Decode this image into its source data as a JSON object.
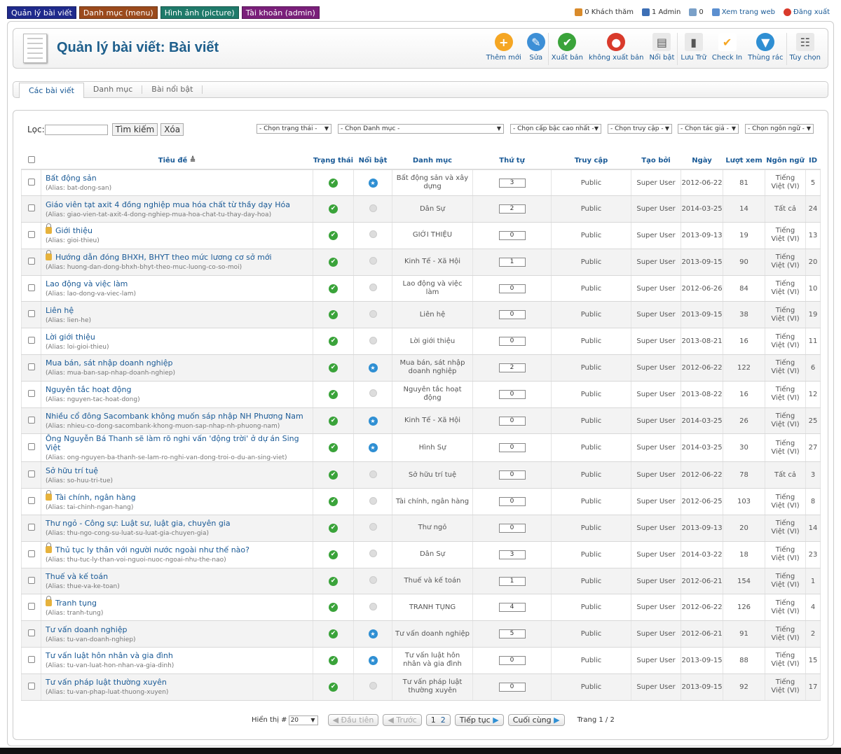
{
  "topmenu": [
    {
      "label": "Quản lý bài viết",
      "color": "#1f2a8c"
    },
    {
      "label": "Danh mục (menu)",
      "color": "#9b4a1c"
    },
    {
      "label": "Hình ảnh (picture)",
      "color": "#1f7a6a"
    },
    {
      "label": "Tài khoản (admin)",
      "color": "#7a1f7a"
    }
  ],
  "topright": {
    "guests": "0 Khách thăm",
    "admins": "1 Admin",
    "messages": "0",
    "view_site": "Xem trang web",
    "logout": "Đăng xuất"
  },
  "header": {
    "title": "Quản lý bài viết: Bài viết"
  },
  "toolbar": [
    {
      "label": "Thêm mới",
      "color": "#f5a623",
      "glyph": "+"
    },
    {
      "label": "Sửa",
      "color": "#3d8fd6",
      "glyph": "✎"
    },
    {
      "label": "Xuất bản",
      "color": "#3aa33a",
      "glyph": "✔"
    },
    {
      "label": "không xuất bản",
      "color": "#d93a2b",
      "glyph": "●"
    },
    {
      "label": "Nổi bật",
      "color": "#e9e9e9",
      "glyph": "▤"
    },
    {
      "label": "Lưu Trữ",
      "color": "#e9e9e9",
      "glyph": "▮"
    },
    {
      "label": "Check In",
      "color": "#ffffff",
      "glyph": "✔"
    },
    {
      "label": "Thùng rác",
      "color": "#2f8fd3",
      "glyph": "▼"
    },
    {
      "label": "Tùy chọn",
      "color": "#e9e9e9",
      "glyph": "☷"
    }
  ],
  "submenu": [
    "Các bài viết",
    "Danh mục",
    "Bài nổi bật"
  ],
  "filter": {
    "label": "Lọc:",
    "search_btn": "Tìm kiếm",
    "clear_btn": "Xóa"
  },
  "selects": [
    "- Chọn trạng thái -",
    "- Chọn Danh mục -",
    "- Chọn cấp bậc cao nhất -",
    "- Chọn truy cập -",
    "- Chọn tác giả -",
    "- Chọn ngôn ngữ -"
  ],
  "columns": [
    "Tiêu đề",
    "Trạng thái",
    "Nổi bật",
    "Danh mục",
    "Thứ tự",
    "Truy cập",
    "Tạo bởi",
    "Ngày",
    "Lượt xem",
    "Ngôn ngữ",
    "ID"
  ],
  "rows": [
    {
      "title": "Bất động sản",
      "alias": "(Alias: bat-dong-san)",
      "locked": false,
      "featured": true,
      "category": "Bất động sản và xây dựng",
      "order": "3",
      "access": "Public",
      "author": "Super User",
      "date": "2012-06-22",
      "hits": "81",
      "lang": "Tiếng Việt (VI)",
      "id": "5"
    },
    {
      "title": "Giáo viên tạt axit 4 đồng nghiệp mua hóa chất từ thầy dạy Hóa",
      "alias": "(Alias: giao-vien-tat-axit-4-dong-nghiep-mua-hoa-chat-tu-thay-day-hoa)",
      "locked": false,
      "featured": false,
      "category": "Dân Sự",
      "order": "2",
      "access": "Public",
      "author": "Super User",
      "date": "2014-03-25",
      "hits": "14",
      "lang": "Tất cả",
      "id": "24"
    },
    {
      "title": "Giới thiệu",
      "alias": "(Alias: gioi-thieu)",
      "locked": true,
      "featured": false,
      "category": "GIỚI THIỆU",
      "order": "0",
      "access": "Public",
      "author": "Super User",
      "date": "2013-09-13",
      "hits": "19",
      "lang": "Tiếng Việt (VI)",
      "id": "13"
    },
    {
      "title": "Hướng dẫn đóng BHXH, BHYT theo mức lương cơ sở mới",
      "alias": "(Alias: huong-dan-dong-bhxh-bhyt-theo-muc-luong-co-so-moi)",
      "locked": true,
      "featured": false,
      "category": "Kinh Tế - Xã Hội",
      "order": "1",
      "access": "Public",
      "author": "Super User",
      "date": "2013-09-15",
      "hits": "90",
      "lang": "Tiếng Việt (VI)",
      "id": "20"
    },
    {
      "title": "Lao động và việc làm",
      "alias": "(Alias: lao-dong-va-viec-lam)",
      "locked": false,
      "featured": false,
      "category": "Lao động và việc làm",
      "order": "0",
      "access": "Public",
      "author": "Super User",
      "date": "2012-06-26",
      "hits": "84",
      "lang": "Tiếng Việt (VI)",
      "id": "10"
    },
    {
      "title": "Liên hệ",
      "alias": "(Alias: lien-he)",
      "locked": false,
      "featured": false,
      "category": "Liên hệ",
      "order": "0",
      "access": "Public",
      "author": "Super User",
      "date": "2013-09-15",
      "hits": "38",
      "lang": "Tiếng Việt (VI)",
      "id": "19"
    },
    {
      "title": "Lời giới thiệu",
      "alias": "(Alias: loi-gioi-thieu)",
      "locked": false,
      "featured": false,
      "category": "Lời giới thiệu",
      "order": "0",
      "access": "Public",
      "author": "Super User",
      "date": "2013-08-21",
      "hits": "16",
      "lang": "Tiếng Việt (VI)",
      "id": "11"
    },
    {
      "title": "Mua bán, sát nhập doanh nghiệp",
      "alias": "(Alias: mua-ban-sap-nhap-doanh-nghiep)",
      "locked": false,
      "featured": true,
      "category": "Mua bán, sát nhập doanh nghiệp",
      "order": "2",
      "access": "Public",
      "author": "Super User",
      "date": "2012-06-22",
      "hits": "122",
      "lang": "Tiếng Việt (VI)",
      "id": "6"
    },
    {
      "title": "Nguyên tắc hoạt động",
      "alias": "(Alias: nguyen-tac-hoat-dong)",
      "locked": false,
      "featured": false,
      "category": "Nguyên tắc hoạt động",
      "order": "0",
      "access": "Public",
      "author": "Super User",
      "date": "2013-08-22",
      "hits": "16",
      "lang": "Tiếng Việt (VI)",
      "id": "12"
    },
    {
      "title": "Nhiều cổ đông Sacombank không muốn sáp nhập NH Phương Nam",
      "alias": "(Alias: nhieu-co-dong-sacombank-khong-muon-sap-nhap-nh-phuong-nam)",
      "locked": false,
      "featured": true,
      "category": "Kinh Tế - Xã Hội",
      "order": "0",
      "access": "Public",
      "author": "Super User",
      "date": "2014-03-25",
      "hits": "26",
      "lang": "Tiếng Việt (VI)",
      "id": "25"
    },
    {
      "title": "Ông Nguyễn Bá Thanh sẽ làm rõ nghi vấn 'động trời' ở dự án Sing Việt",
      "alias": "(Alias: ong-nguyen-ba-thanh-se-lam-ro-nghi-van-dong-troi-o-du-an-sing-viet)",
      "locked": false,
      "featured": true,
      "category": "Hình Sự",
      "order": "0",
      "access": "Public",
      "author": "Super User",
      "date": "2014-03-25",
      "hits": "30",
      "lang": "Tiếng Việt (VI)",
      "id": "27"
    },
    {
      "title": "Sở hữu trí tuệ",
      "alias": "(Alias: so-huu-tri-tue)",
      "locked": false,
      "featured": false,
      "category": "Sở hữu trí tuệ",
      "order": "0",
      "access": "Public",
      "author": "Super User",
      "date": "2012-06-22",
      "hits": "78",
      "lang": "Tất cả",
      "id": "3"
    },
    {
      "title": "Tài chính, ngân hàng",
      "alias": "(Alias: tai-chinh-ngan-hang)",
      "locked": true,
      "featured": false,
      "category": "Tài chính, ngân hàng",
      "order": "0",
      "access": "Public",
      "author": "Super User",
      "date": "2012-06-25",
      "hits": "103",
      "lang": "Tiếng Việt (VI)",
      "id": "8"
    },
    {
      "title": "Thư ngỏ - Công sự: Luật sư, luật gia, chuyên gia",
      "alias": "(Alias: thu-ngo-cong-su-luat-su-luat-gia-chuyen-gia)",
      "locked": false,
      "featured": false,
      "category": "Thư ngỏ",
      "order": "0",
      "access": "Public",
      "author": "Super User",
      "date": "2013-09-13",
      "hits": "20",
      "lang": "Tiếng Việt (VI)",
      "id": "14"
    },
    {
      "title": "Thủ tục ly thân với người nước ngoài như thế nào?",
      "alias": "(Alias: thu-tuc-ly-than-voi-nguoi-nuoc-ngoai-nhu-the-nao)",
      "locked": true,
      "featured": false,
      "category": "Dân Sự",
      "order": "3",
      "access": "Public",
      "author": "Super User",
      "date": "2014-03-22",
      "hits": "18",
      "lang": "Tiếng Việt (VI)",
      "id": "23"
    },
    {
      "title": "Thuế và kế toán",
      "alias": "(Alias: thue-va-ke-toan)",
      "locked": false,
      "featured": false,
      "category": "Thuế và kế toán",
      "order": "1",
      "access": "Public",
      "author": "Super User",
      "date": "2012-06-21",
      "hits": "154",
      "lang": "Tiếng Việt (VI)",
      "id": "1"
    },
    {
      "title": "Tranh tụng",
      "alias": "(Alias: tranh-tung)",
      "locked": true,
      "featured": false,
      "category": "TRANH TỤNG",
      "order": "4",
      "access": "Public",
      "author": "Super User",
      "date": "2012-06-22",
      "hits": "126",
      "lang": "Tiếng Việt (VI)",
      "id": "4"
    },
    {
      "title": "Tư vấn doanh nghiệp",
      "alias": "(Alias: tu-van-doanh-nghiep)",
      "locked": false,
      "featured": true,
      "category": "Tư vấn doanh nghiệp",
      "order": "5",
      "access": "Public",
      "author": "Super User",
      "date": "2012-06-21",
      "hits": "91",
      "lang": "Tiếng Việt (VI)",
      "id": "2"
    },
    {
      "title": "Tư vấn luật hôn nhân và gia đình",
      "alias": "(Alias: tu-van-luat-hon-nhan-va-gia-dinh)",
      "locked": false,
      "featured": true,
      "category": "Tư vấn luật hôn nhân và gia đình",
      "order": "0",
      "access": "Public",
      "author": "Super User",
      "date": "2013-09-15",
      "hits": "88",
      "lang": "Tiếng Việt (VI)",
      "id": "15"
    },
    {
      "title": "Tư vấn pháp luật thường xuyên",
      "alias": "(Alias: tu-van-phap-luat-thuong-xuyen)",
      "locked": false,
      "featured": false,
      "category": "Tư vấn pháp luật thường xuyên",
      "order": "0",
      "access": "Public",
      "author": "Super User",
      "date": "2013-09-15",
      "hits": "92",
      "lang": "Tiếng Việt (VI)",
      "id": "17"
    }
  ],
  "pager": {
    "show_label": "Hiển thị #",
    "show_value": "20",
    "first": "Đầu tiên",
    "prev": "Trước",
    "pages": [
      "1",
      "2"
    ],
    "next": "Tiếp tục",
    "last": "Cuối cùng",
    "page_info": "Trang 1 / 2"
  }
}
